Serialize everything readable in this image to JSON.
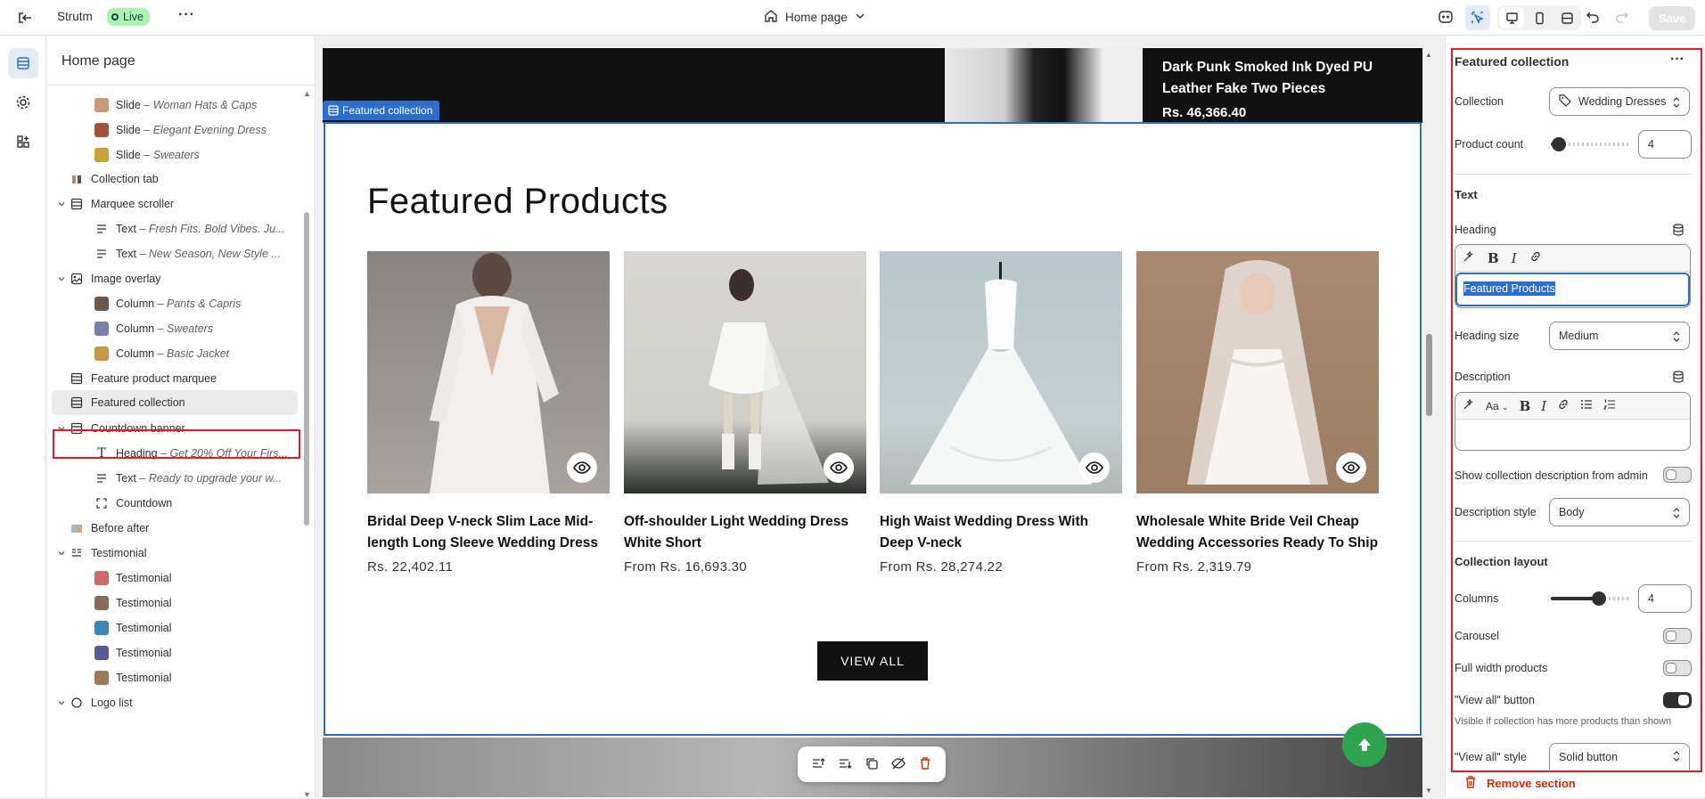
{
  "topbar": {
    "store_name": "Strutm",
    "status_badge": "Live",
    "page_selector": "Home page",
    "save_label": "Save"
  },
  "sidebar": {
    "title": "Home page",
    "items": [
      {
        "type": "Slide",
        "detail": "Woman Hats & Caps",
        "indent": 2
      },
      {
        "type": "Slide",
        "detail": "Elegant Evening Dress",
        "indent": 2
      },
      {
        "type": "Slide",
        "detail": "Sweaters",
        "indent": 2
      },
      {
        "type": "Collection tab",
        "detail": "",
        "indent": 1
      },
      {
        "type": "Marquee scroller",
        "detail": "",
        "indent": 1
      },
      {
        "type": "Text",
        "detail": "Fresh Fits. Bold Vibes. Ju...",
        "indent": 2
      },
      {
        "type": "Text",
        "detail": "New Season, New Style ...",
        "indent": 2
      },
      {
        "type": "Image overlay",
        "detail": "",
        "indent": 1
      },
      {
        "type": "Column",
        "detail": "Pants & Capris",
        "indent": 2
      },
      {
        "type": "Column",
        "detail": "Sweaters",
        "indent": 2
      },
      {
        "type": "Column",
        "detail": "Basic Jacket",
        "indent": 2
      },
      {
        "type": "Feature product marquee",
        "detail": "",
        "indent": 1
      },
      {
        "type": "Featured collection",
        "detail": "",
        "indent": 1
      },
      {
        "type": "Countdown banner",
        "detail": "",
        "indent": 1
      },
      {
        "type": "Heading",
        "detail": "Get 20% Off Your Firs...",
        "indent": 2
      },
      {
        "type": "Text",
        "detail": "Ready to upgrade your w...",
        "indent": 2
      },
      {
        "type": "Countdown",
        "detail": "",
        "indent": 2
      },
      {
        "type": "Before after",
        "detail": "",
        "indent": 1
      },
      {
        "type": "Testimonial",
        "detail": "",
        "indent": 1
      },
      {
        "type": "Testimonial",
        "detail": "",
        "indent": 2
      },
      {
        "type": "Testimonial",
        "detail": "",
        "indent": 2
      },
      {
        "type": "Testimonial",
        "detail": "",
        "indent": 2
      },
      {
        "type": "Testimonial",
        "detail": "",
        "indent": 2
      },
      {
        "type": "Testimonial",
        "detail": "",
        "indent": 2
      },
      {
        "type": "Logo list",
        "detail": "",
        "indent": 1
      }
    ]
  },
  "canvas": {
    "hero_title": "Dark Punk Smoked Ink Dyed PU Leather Fake Two Pieces",
    "hero_price": "Rs. 46,366.40",
    "section_tag": "Featured collection",
    "heading": "Featured Products",
    "products": [
      {
        "name": "Bridal Deep V-neck Slim Lace Mid-length Long Sleeve Wedding Dress",
        "price": "Rs. 22,402.11"
      },
      {
        "name": "Off-shoulder Light Wedding Dress White Short",
        "price": "From Rs. 16,693.30"
      },
      {
        "name": "High Waist Wedding Dress With Deep V-neck",
        "price": "From Rs. 28,274.22"
      },
      {
        "name": "Wholesale White Bride Veil Cheap Wedding Accessories Ready To Ship",
        "price": "From Rs. 2,319.79"
      }
    ],
    "view_all": "VIEW ALL"
  },
  "panel": {
    "title": "Featured collection",
    "collection_label": "Collection",
    "collection_value": "Wedding Dresses",
    "product_count_label": "Product count",
    "product_count": "4",
    "product_count_fraction": 0.1,
    "text_heading": "Text",
    "heading_label": "Heading",
    "heading_value": "Featured Products",
    "heading_size_label": "Heading size",
    "heading_size_value": "Medium",
    "description_label": "Description",
    "show_desc_label": "Show collection description from admin",
    "desc_style_label": "Description style",
    "desc_style_value": "Body",
    "layout_heading": "Collection layout",
    "columns_label": "Columns",
    "columns_value": "4",
    "columns_fraction": 0.6,
    "carousel_label": "Carousel",
    "full_width_label": "Full width products",
    "view_all_button_label": "\"View all\" button",
    "view_all_help": "Visible if collection has more products than shown",
    "view_all_style_label": "\"View all\" style",
    "view_all_style_value": "Solid button",
    "remove_label": "Remove section",
    "text_size_label": "Aa"
  },
  "colors": {
    "accent_blue": "#2c6ecb",
    "highlight_red": "#e51c23",
    "live_green": "#aff0b5",
    "fab_green": "#2ea44f"
  }
}
